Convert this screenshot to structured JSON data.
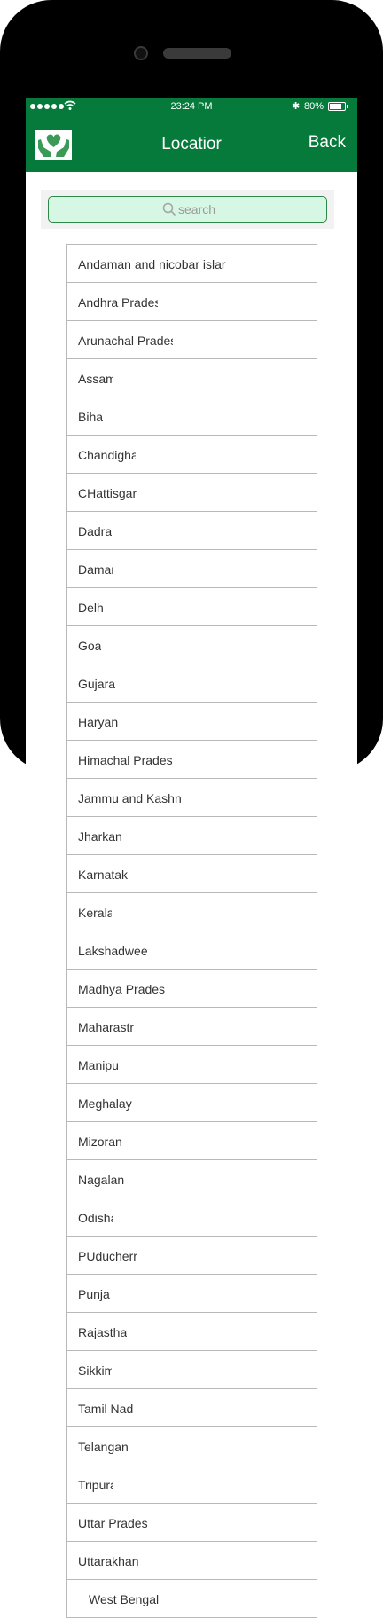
{
  "status_bar": {
    "time": "23:24 PM",
    "battery_pct": "80%",
    "battery_level": 0.8
  },
  "header": {
    "title": "Locatior",
    "back_label": "Back"
  },
  "search": {
    "placeholder": "search"
  },
  "states": [
    "Andaman and nicobar islar",
    "Andhra Prades",
    "Arunachal Prades",
    "Assam",
    "Biha",
    "Chandigha",
    "CHattisgar",
    "Dadra",
    "Damar",
    "Delh",
    "Goa",
    "Gujara",
    "Haryan",
    "Himachal Prades",
    "Jammu and Kashn",
    "Jharkan",
    "Karnatak",
    "Kerala",
    "Lakshadwee",
    "Madhya Prades",
    "Maharastr",
    "Manipu",
    "Meghalay",
    "Mizoran",
    "Nagalan",
    "Odisha",
    "PUducherr",
    "Punjal",
    "Rajastha",
    "Sikkim",
    "Tamil Nad",
    "Telangan",
    "Tripura",
    "Uttar Prades",
    "Uttarakhan",
    "West Bengal"
  ],
  "colors": {
    "brand_green": "#057a3a",
    "search_bg": "#d6f7e4",
    "search_border": "#2f8a4a"
  }
}
